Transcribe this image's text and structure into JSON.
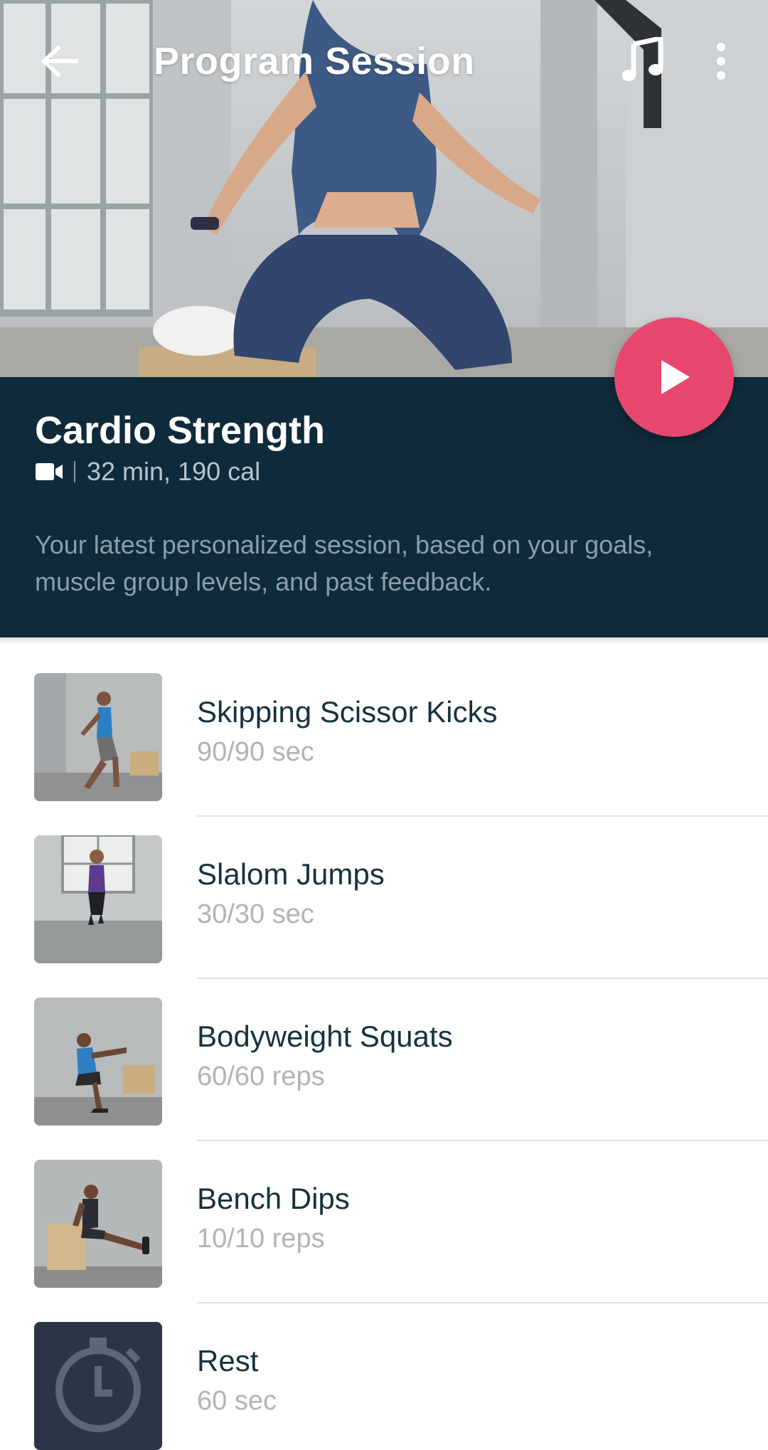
{
  "header": {
    "title": "Program Session",
    "back_icon": "arrow-left-icon",
    "music_icon": "music-note-icon",
    "more_icon": "more-vertical-icon"
  },
  "session": {
    "title": "Cardio Strength",
    "type_icon": "video-camera-icon",
    "meta": "32 min, 190 cal",
    "description": "Your latest personalized session, based on your goals, muscle group levels, and past feedback.",
    "play_icon": "play-icon"
  },
  "exercises": [
    {
      "name": "Skipping Scissor Kicks",
      "detail": "90/90 sec"
    },
    {
      "name": "Slalom Jumps",
      "detail": "30/30 sec"
    },
    {
      "name": "Bodyweight Squats",
      "detail": "60/60 reps"
    },
    {
      "name": "Bench Dips",
      "detail": "10/10 reps"
    },
    {
      "name": "Rest",
      "detail": "60 sec"
    }
  ],
  "colors": {
    "panel": "#0f2a3a",
    "accent": "#e8476d",
    "item_title": "#16323f",
    "item_detail": "#b3b3b3"
  }
}
